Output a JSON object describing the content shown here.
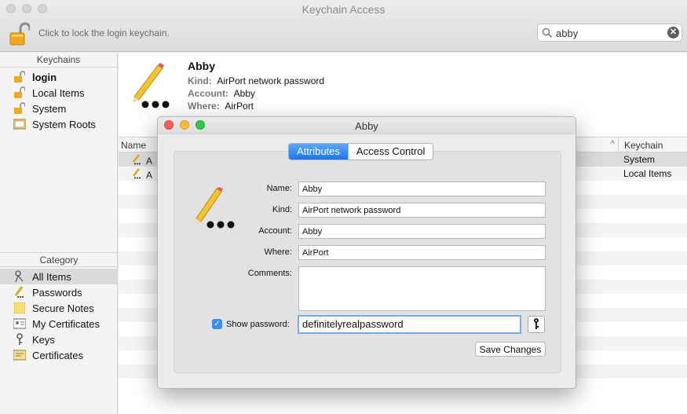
{
  "window": {
    "title": "Keychain Access",
    "lock_hint": "Click to lock the login keychain."
  },
  "search": {
    "value": "abby",
    "clear_glyph": "✕"
  },
  "sidebar": {
    "keychains_header": "Keychains",
    "keychains": [
      {
        "label": "login",
        "icon": "lock-open-icon"
      },
      {
        "label": "Local Items",
        "icon": "lock-open-icon"
      },
      {
        "label": "System",
        "icon": "lock-open-icon"
      },
      {
        "label": "System Roots",
        "icon": "folder-cert-icon"
      }
    ],
    "category_header": "Category",
    "categories": [
      {
        "label": "All Items",
        "icon": "all-items-icon"
      },
      {
        "label": "Passwords",
        "icon": "pencil-icon"
      },
      {
        "label": "Secure Notes",
        "icon": "note-icon"
      },
      {
        "label": "My Certificates",
        "icon": "my-cert-icon"
      },
      {
        "label": "Keys",
        "icon": "key-icon"
      },
      {
        "label": "Certificates",
        "icon": "cert-icon"
      }
    ]
  },
  "info": {
    "title": "Abby",
    "kind_label": "Kind:",
    "kind_value": "AirPort network password",
    "account_label": "Account:",
    "account_value": "Abby",
    "where_label": "Where:",
    "where_value": "AirPort"
  },
  "table": {
    "col_name": "Name",
    "col_keychain": "Keychain",
    "sort_caret": "^",
    "rows": [
      {
        "name": "A",
        "keychain": "System"
      },
      {
        "name": "A",
        "keychain": "Local Items"
      }
    ]
  },
  "dialog": {
    "title": "Abby",
    "tabs": [
      "Attributes",
      "Access Control"
    ],
    "labels": {
      "name": "Name:",
      "kind": "Kind:",
      "account": "Account:",
      "where": "Where:",
      "comments": "Comments:",
      "show_password": "Show password:"
    },
    "values": {
      "name": "Abby",
      "kind": "AirPort network password",
      "account": "Abby",
      "where": "AirPort",
      "comments": "",
      "password": "definitelyrealpassword"
    },
    "checkbox_glyph": "✓",
    "save_button": "Save Changes"
  },
  "colors": {
    "accent": "#1e78f0",
    "close": "#fc605c",
    "minimize": "#fdbc40",
    "zoom": "#34c84a"
  }
}
